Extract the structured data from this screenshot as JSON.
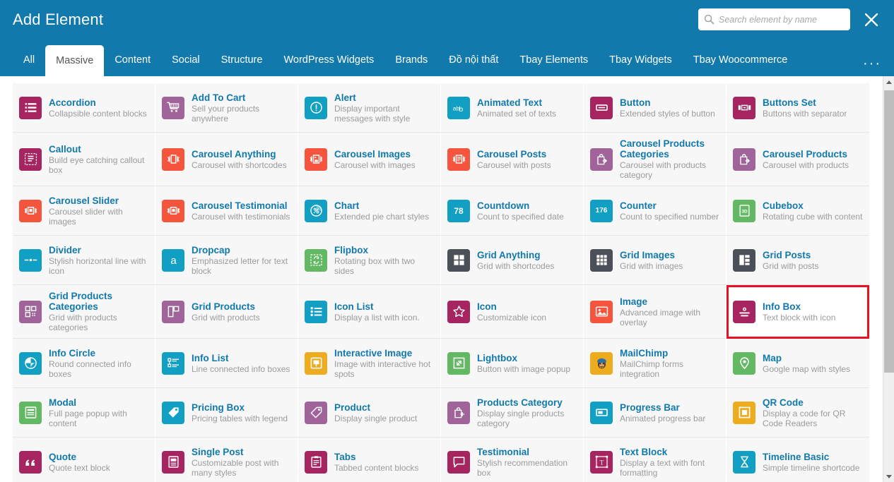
{
  "header": {
    "title": "Add Element",
    "search_placeholder": "Search element by name",
    "search_value": "",
    "close_label": "✕",
    "more_label": "···",
    "accent_color": "#1179ab",
    "highlight_color": "#e81123"
  },
  "tabs": [
    {
      "label": "All",
      "active": false
    },
    {
      "label": "Massive",
      "active": true
    },
    {
      "label": "Content",
      "active": false
    },
    {
      "label": "Social",
      "active": false
    },
    {
      "label": "Structure",
      "active": false
    },
    {
      "label": "WordPress Widgets",
      "active": false
    },
    {
      "label": "Brands",
      "active": false
    },
    {
      "label": "Đồ nội thất",
      "active": false
    },
    {
      "label": "Tbay Elements",
      "active": false
    },
    {
      "label": "Tbay Widgets",
      "active": false
    },
    {
      "label": "Tbay Woocommerce",
      "active": false
    }
  ],
  "colors": {
    "crimson": "#a62460",
    "purple": "#a0649a",
    "cyan": "#11a0c4",
    "red": "#f4553c",
    "green": "#63b863",
    "darkgray": "#4a4f58",
    "orange": "#edab1e"
  },
  "elements": [
    {
      "name": "Accordion",
      "desc": "Collapsible content blocks",
      "icon": "list-lines-icon",
      "color": "crimson",
      "selected": false
    },
    {
      "name": "Add To Cart",
      "desc": "Sell your products anywhere",
      "icon": "shopping-cart-icon",
      "color": "purple",
      "selected": false
    },
    {
      "name": "Alert",
      "desc": "Display important messages with style",
      "icon": "exclamation-circle-icon",
      "color": "cyan",
      "selected": false
    },
    {
      "name": "Animated Text",
      "desc": "Animated set of texts",
      "icon": "animated-letters-icon",
      "color": "cyan",
      "selected": false
    },
    {
      "name": "Button",
      "desc": "Extended styles of button",
      "icon": "button-rect-icon",
      "color": "crimson",
      "selected": false
    },
    {
      "name": "Buttons Set",
      "desc": "Buttons with separator",
      "icon": "buttons-group-icon",
      "color": "crimson",
      "selected": false
    },
    {
      "name": "Callout",
      "desc": "Build eye catching callout box",
      "icon": "dashed-box-icon",
      "color": "crimson",
      "selected": false
    },
    {
      "name": "Carousel Anything",
      "desc": "Carousel with shortcodes",
      "icon": "carousel-icon",
      "color": "red",
      "selected": false
    },
    {
      "name": "Carousel Images",
      "desc": "Carousel with images",
      "icon": "carousel-image-icon",
      "color": "red",
      "selected": false
    },
    {
      "name": "Carousel Posts",
      "desc": "Carousel with posts",
      "icon": "carousel-post-icon",
      "color": "red",
      "selected": false
    },
    {
      "name": "Carousel Products Categories",
      "desc": "Carousel with products category",
      "icon": "bag-arrow-icon",
      "color": "purple",
      "selected": false
    },
    {
      "name": "Carousel Products",
      "desc": "Carousel with products",
      "icon": "bag-arrow-icon",
      "color": "purple",
      "selected": false
    },
    {
      "name": "Carousel Slider",
      "desc": "Carousel slider with images",
      "icon": "carousel-slider-icon",
      "color": "red",
      "selected": false
    },
    {
      "name": "Carousel Testimonial",
      "desc": "Carousel with testimonials",
      "icon": "carousel-quote-icon",
      "color": "red",
      "selected": false
    },
    {
      "name": "Chart",
      "desc": "Extended pie chart styles",
      "icon": "pie-percent-icon",
      "color": "cyan",
      "selected": false
    },
    {
      "name": "Countdown",
      "desc": "Count to specified date",
      "icon": "number-78-icon",
      "color": "cyan",
      "selected": false
    },
    {
      "name": "Counter",
      "desc": "Count to specified number",
      "icon": "number-176-icon",
      "color": "cyan",
      "selected": false
    },
    {
      "name": "Cubebox",
      "desc": "Rotating cube with content",
      "icon": "cube-3d-icon",
      "color": "green",
      "selected": false
    },
    {
      "name": "Divider",
      "desc": "Stylish horizontal line with icon",
      "icon": "divider-line-icon",
      "color": "cyan",
      "selected": false
    },
    {
      "name": "Dropcap",
      "desc": "Emphasized letter for text block",
      "icon": "letter-a-icon",
      "color": "cyan",
      "selected": false
    },
    {
      "name": "Flipbox",
      "desc": "Rotating box with two sides",
      "icon": "flip-box-icon",
      "color": "green",
      "selected": false
    },
    {
      "name": "Grid Anything",
      "desc": "Grid with shortcodes",
      "icon": "grid-four-icon",
      "color": "darkgray",
      "selected": false
    },
    {
      "name": "Grid Images",
      "desc": "Grid with images",
      "icon": "grid-nine-icon",
      "color": "darkgray",
      "selected": false
    },
    {
      "name": "Grid Posts",
      "desc": "Grid with posts",
      "icon": "grid-posts-icon",
      "color": "darkgray",
      "selected": false
    },
    {
      "name": "Grid Products Categories",
      "desc": "Grid with products categories",
      "icon": "grid-products-cat-icon",
      "color": "purple",
      "selected": false
    },
    {
      "name": "Grid Products",
      "desc": "Grid with products",
      "icon": "grid-products-icon",
      "color": "purple",
      "selected": false
    },
    {
      "name": "Icon List",
      "desc": "Display a list with icon.",
      "icon": "icon-list-icon",
      "color": "cyan",
      "selected": false
    },
    {
      "name": "Icon",
      "desc": "Customizable icon",
      "icon": "star-icon",
      "color": "crimson",
      "selected": false
    },
    {
      "name": "Image",
      "desc": "Advanced image with overlay",
      "icon": "picture-icon",
      "color": "red",
      "selected": false
    },
    {
      "name": "Info Box",
      "desc": "Text block with icon",
      "icon": "info-box-icon",
      "color": "crimson",
      "selected": true
    },
    {
      "name": "Info Circle",
      "desc": "Round connected info boxes",
      "icon": "info-circle-icon",
      "color": "cyan",
      "selected": false
    },
    {
      "name": "Info List",
      "desc": "Line connected info boxes",
      "icon": "info-list-icon",
      "color": "cyan",
      "selected": false
    },
    {
      "name": "Interactive Image",
      "desc": "Image with interactive hot spots",
      "icon": "hotspot-icon",
      "color": "orange",
      "selected": false
    },
    {
      "name": "Lightbox",
      "desc": "Button with image popup",
      "icon": "expand-arrows-icon",
      "color": "green",
      "selected": false
    },
    {
      "name": "MailChimp",
      "desc": "MailChimp forms integration",
      "icon": "mailchimp-monkey-icon",
      "color": "orange",
      "selected": false
    },
    {
      "name": "Map",
      "desc": "Google map with styles",
      "icon": "map-pin-icon",
      "color": "green",
      "selected": false
    },
    {
      "name": "Modal",
      "desc": "Full page popup with content",
      "icon": "modal-window-icon",
      "color": "green",
      "selected": false
    },
    {
      "name": "Pricing Box",
      "desc": "Pricing tables with legend",
      "icon": "price-tag-icon",
      "color": "cyan",
      "selected": false
    },
    {
      "name": "Product",
      "desc": "Display single product",
      "icon": "tag-icon",
      "color": "purple",
      "selected": false
    },
    {
      "name": "Products Category",
      "desc": "Display single products category",
      "icon": "bag-plus-icon",
      "color": "purple",
      "selected": false
    },
    {
      "name": "Progress Bar",
      "desc": "Animated progress bar",
      "icon": "progress-bar-icon",
      "color": "cyan",
      "selected": false
    },
    {
      "name": "QR Code",
      "desc": "Display a code for QR Code Readers",
      "icon": "qr-square-icon",
      "color": "orange",
      "selected": false
    },
    {
      "name": "Quote",
      "desc": "Quote text block",
      "icon": "quote-marks-icon",
      "color": "crimson",
      "selected": false
    },
    {
      "name": "Single Post",
      "desc": "Customizable post with many styles",
      "icon": "single-post-icon",
      "color": "crimson",
      "selected": false
    },
    {
      "name": "Tabs",
      "desc": "Tabbed content blocks",
      "icon": "tabs-clipboard-icon",
      "color": "crimson",
      "selected": false
    },
    {
      "name": "Testimonial",
      "desc": "Stylish recommendation box",
      "icon": "speech-bubble-icon",
      "color": "crimson",
      "selected": false
    },
    {
      "name": "Text Block",
      "desc": "Display a text with font formatting",
      "icon": "text-t-icon",
      "color": "crimson",
      "selected": false
    },
    {
      "name": "Timeline Basic",
      "desc": "Simple timeline shortcode",
      "icon": "hourglass-icon",
      "color": "cyan",
      "selected": false
    }
  ]
}
